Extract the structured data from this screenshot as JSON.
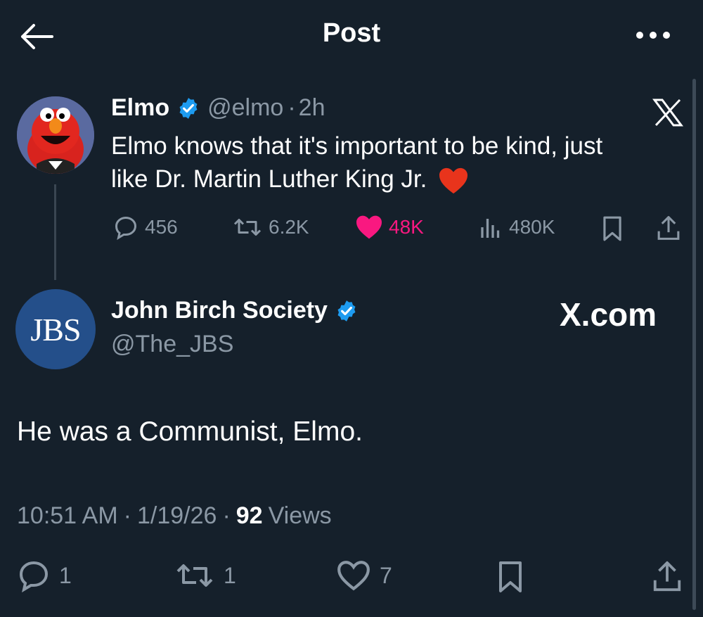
{
  "header": {
    "title": "Post",
    "back_icon": "arrow-left-icon",
    "more_icon": "more-icon"
  },
  "colors": {
    "background": "#15202b",
    "secondary": "#8b98a5",
    "like_pink": "#f91880",
    "verified_blue": "#1d9bf0"
  },
  "quoted_post": {
    "author_name": "Elmo",
    "handle": "@elmo",
    "separator": "·",
    "time": "2h",
    "text_line1": "Elmo knows that it's important to be kind, just",
    "text_line2": "like Dr. Martin Luther King Jr.",
    "emoji": "❤️",
    "watermark_icon": "x-logo-icon",
    "metrics": {
      "replies": "456",
      "reposts": "6.2K",
      "likes": "48K",
      "views": "480K"
    }
  },
  "reply_post": {
    "author_name": "John Birch Society",
    "handle": "@The_JBS",
    "avatar_text": "JBS",
    "watermark": "X.com",
    "text": "He was a Communist, Elmo.",
    "time": "10:51 AM",
    "date": "1/19/26",
    "separator": "·",
    "views_count": "92",
    "views_label": "Views"
  },
  "actions": {
    "replies": "1",
    "reposts": "1",
    "likes": "7"
  }
}
